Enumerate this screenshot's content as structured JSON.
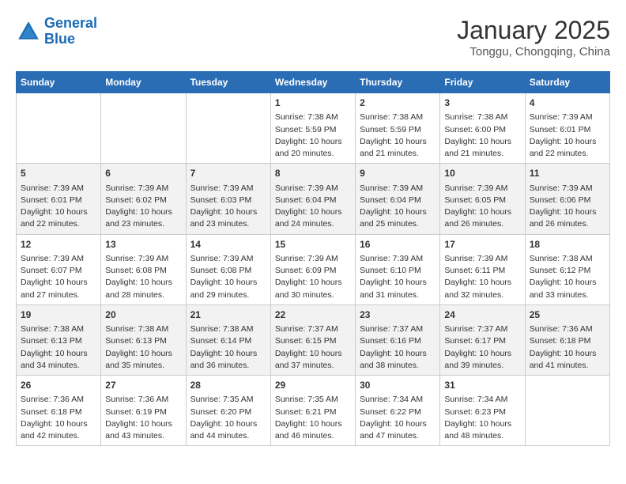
{
  "header": {
    "logo_line1": "General",
    "logo_line2": "Blue",
    "month_year": "January 2025",
    "location": "Tonggu, Chongqing, China"
  },
  "days_of_week": [
    "Sunday",
    "Monday",
    "Tuesday",
    "Wednesday",
    "Thursday",
    "Friday",
    "Saturday"
  ],
  "weeks": [
    [
      {
        "day": "",
        "info": ""
      },
      {
        "day": "",
        "info": ""
      },
      {
        "day": "",
        "info": ""
      },
      {
        "day": "1",
        "info": "Sunrise: 7:38 AM\nSunset: 5:59 PM\nDaylight: 10 hours\nand 20 minutes."
      },
      {
        "day": "2",
        "info": "Sunrise: 7:38 AM\nSunset: 5:59 PM\nDaylight: 10 hours\nand 21 minutes."
      },
      {
        "day": "3",
        "info": "Sunrise: 7:38 AM\nSunset: 6:00 PM\nDaylight: 10 hours\nand 21 minutes."
      },
      {
        "day": "4",
        "info": "Sunrise: 7:39 AM\nSunset: 6:01 PM\nDaylight: 10 hours\nand 22 minutes."
      }
    ],
    [
      {
        "day": "5",
        "info": "Sunrise: 7:39 AM\nSunset: 6:01 PM\nDaylight: 10 hours\nand 22 minutes."
      },
      {
        "day": "6",
        "info": "Sunrise: 7:39 AM\nSunset: 6:02 PM\nDaylight: 10 hours\nand 23 minutes."
      },
      {
        "day": "7",
        "info": "Sunrise: 7:39 AM\nSunset: 6:03 PM\nDaylight: 10 hours\nand 23 minutes."
      },
      {
        "day": "8",
        "info": "Sunrise: 7:39 AM\nSunset: 6:04 PM\nDaylight: 10 hours\nand 24 minutes."
      },
      {
        "day": "9",
        "info": "Sunrise: 7:39 AM\nSunset: 6:04 PM\nDaylight: 10 hours\nand 25 minutes."
      },
      {
        "day": "10",
        "info": "Sunrise: 7:39 AM\nSunset: 6:05 PM\nDaylight: 10 hours\nand 26 minutes."
      },
      {
        "day": "11",
        "info": "Sunrise: 7:39 AM\nSunset: 6:06 PM\nDaylight: 10 hours\nand 26 minutes."
      }
    ],
    [
      {
        "day": "12",
        "info": "Sunrise: 7:39 AM\nSunset: 6:07 PM\nDaylight: 10 hours\nand 27 minutes."
      },
      {
        "day": "13",
        "info": "Sunrise: 7:39 AM\nSunset: 6:08 PM\nDaylight: 10 hours\nand 28 minutes."
      },
      {
        "day": "14",
        "info": "Sunrise: 7:39 AM\nSunset: 6:08 PM\nDaylight: 10 hours\nand 29 minutes."
      },
      {
        "day": "15",
        "info": "Sunrise: 7:39 AM\nSunset: 6:09 PM\nDaylight: 10 hours\nand 30 minutes."
      },
      {
        "day": "16",
        "info": "Sunrise: 7:39 AM\nSunset: 6:10 PM\nDaylight: 10 hours\nand 31 minutes."
      },
      {
        "day": "17",
        "info": "Sunrise: 7:39 AM\nSunset: 6:11 PM\nDaylight: 10 hours\nand 32 minutes."
      },
      {
        "day": "18",
        "info": "Sunrise: 7:38 AM\nSunset: 6:12 PM\nDaylight: 10 hours\nand 33 minutes."
      }
    ],
    [
      {
        "day": "19",
        "info": "Sunrise: 7:38 AM\nSunset: 6:13 PM\nDaylight: 10 hours\nand 34 minutes."
      },
      {
        "day": "20",
        "info": "Sunrise: 7:38 AM\nSunset: 6:13 PM\nDaylight: 10 hours\nand 35 minutes."
      },
      {
        "day": "21",
        "info": "Sunrise: 7:38 AM\nSunset: 6:14 PM\nDaylight: 10 hours\nand 36 minutes."
      },
      {
        "day": "22",
        "info": "Sunrise: 7:37 AM\nSunset: 6:15 PM\nDaylight: 10 hours\nand 37 minutes."
      },
      {
        "day": "23",
        "info": "Sunrise: 7:37 AM\nSunset: 6:16 PM\nDaylight: 10 hours\nand 38 minutes."
      },
      {
        "day": "24",
        "info": "Sunrise: 7:37 AM\nSunset: 6:17 PM\nDaylight: 10 hours\nand 39 minutes."
      },
      {
        "day": "25",
        "info": "Sunrise: 7:36 AM\nSunset: 6:18 PM\nDaylight: 10 hours\nand 41 minutes."
      }
    ],
    [
      {
        "day": "26",
        "info": "Sunrise: 7:36 AM\nSunset: 6:18 PM\nDaylight: 10 hours\nand 42 minutes."
      },
      {
        "day": "27",
        "info": "Sunrise: 7:36 AM\nSunset: 6:19 PM\nDaylight: 10 hours\nand 43 minutes."
      },
      {
        "day": "28",
        "info": "Sunrise: 7:35 AM\nSunset: 6:20 PM\nDaylight: 10 hours\nand 44 minutes."
      },
      {
        "day": "29",
        "info": "Sunrise: 7:35 AM\nSunset: 6:21 PM\nDaylight: 10 hours\nand 46 minutes."
      },
      {
        "day": "30",
        "info": "Sunrise: 7:34 AM\nSunset: 6:22 PM\nDaylight: 10 hours\nand 47 minutes."
      },
      {
        "day": "31",
        "info": "Sunrise: 7:34 AM\nSunset: 6:23 PM\nDaylight: 10 hours\nand 48 minutes."
      },
      {
        "day": "",
        "info": ""
      }
    ]
  ]
}
